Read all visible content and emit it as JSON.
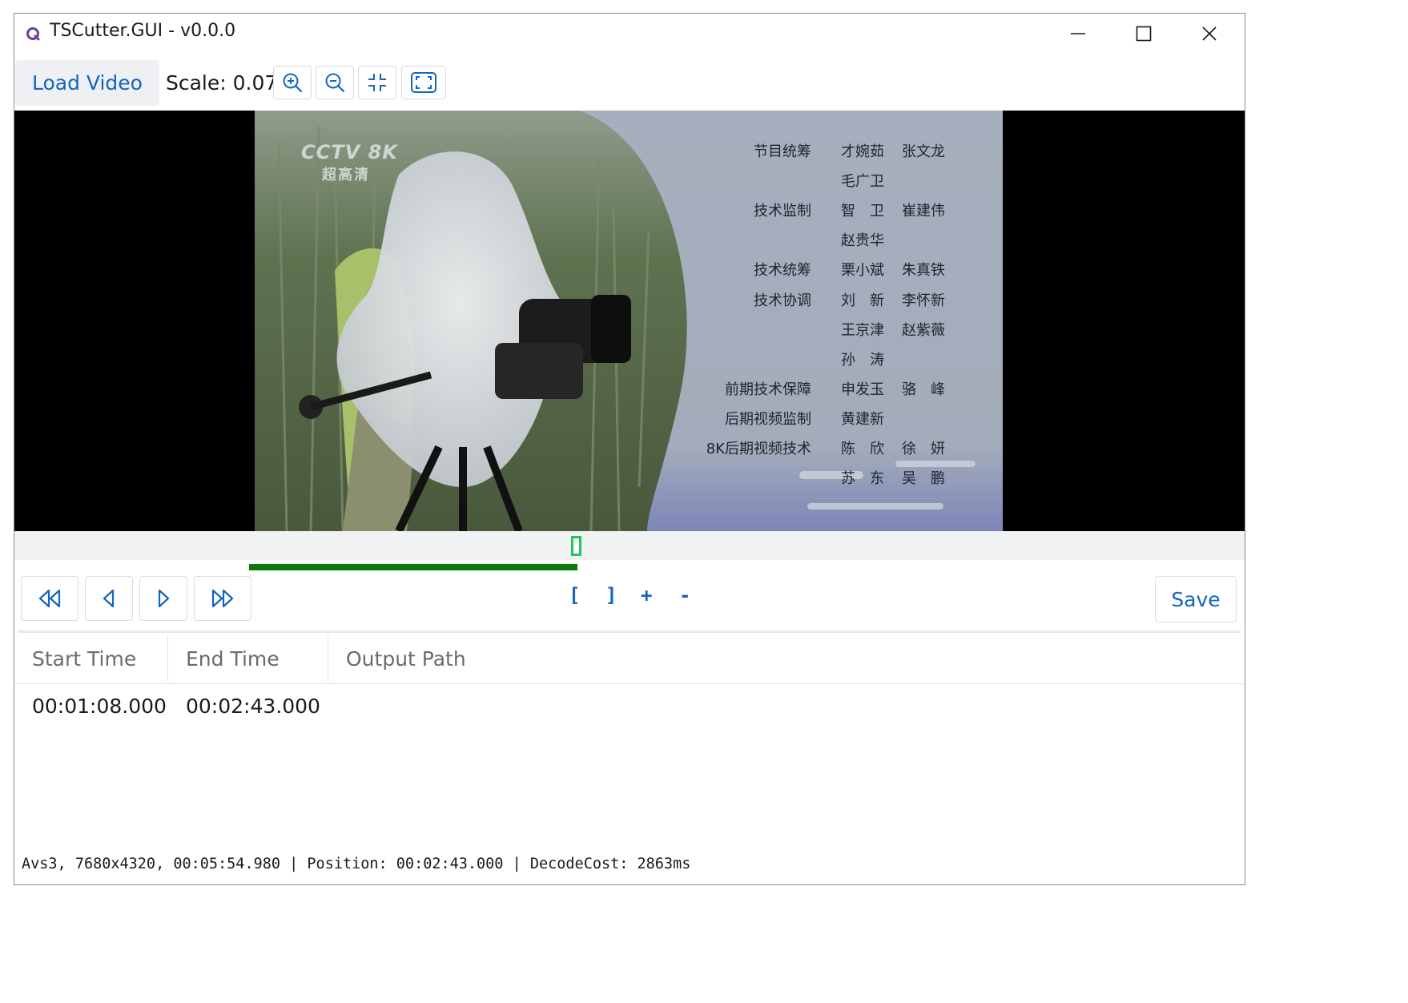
{
  "window": {
    "title": "TSCutter.GUI - v0.0.0",
    "icons": {
      "minimize": "minimize-icon",
      "maximize": "maximize-icon",
      "close": "close-icon"
    }
  },
  "toolbar": {
    "load_video_label": "Load Video",
    "scale_text": "Scale: 0.07",
    "icons": [
      "zoom-in-icon",
      "zoom-out-icon",
      "fit-to-window-icon",
      "fullscreen-icon"
    ]
  },
  "video": {
    "watermark_top": "CCTV 8K",
    "watermark_bottom": "超高清",
    "credits": [
      {
        "role": "节目统筹",
        "names": [
          "才婉茹",
          "张文龙"
        ]
      },
      {
        "role": "",
        "names": [
          "毛广卫"
        ]
      },
      {
        "role": "技术监制",
        "names": [
          "智　卫",
          "崔建伟"
        ]
      },
      {
        "role": "",
        "names": [
          "赵贵华"
        ]
      },
      {
        "role": "技术统筹",
        "names": [
          "栗小斌",
          "朱真铁"
        ]
      },
      {
        "role": "技术协调",
        "names": [
          "刘　新",
          "李怀新"
        ]
      },
      {
        "role": "",
        "names": [
          "王京津",
          "赵紫薇"
        ]
      },
      {
        "role": "",
        "names": [
          "孙　涛"
        ]
      },
      {
        "role": "前期技术保障",
        "names": [
          "申发玉",
          "骆　峰"
        ]
      },
      {
        "role": "后期视频监制",
        "names": [
          "黄建新"
        ]
      },
      {
        "role": "8K后期视频技术",
        "names": [
          "陈　欣",
          "徐　妍"
        ]
      },
      {
        "role": "",
        "names": [
          "苏　东",
          "吴　鹏"
        ]
      }
    ]
  },
  "timeline": {
    "played_fraction": 0.468,
    "accent_color": "#0a7a0a",
    "marker_color": "#22c55e"
  },
  "controls": {
    "icons": [
      "skip-back-icon",
      "step-back-icon",
      "step-forward-icon",
      "skip-forward-icon"
    ],
    "mark_start": "[",
    "mark_end": "]",
    "add": "+",
    "remove": "-",
    "save_label": "Save"
  },
  "table": {
    "headers": [
      "Start Time",
      "End Time",
      "Output Path"
    ],
    "rows": [
      {
        "start": "00:01:08.000",
        "end": "00:02:43.000",
        "output": ""
      }
    ]
  },
  "status_bar": {
    "text": "Avs3, 7680x4320, 00:05:54.980 | Position: 00:02:43.000 | DecodeCost: 2863ms"
  },
  "colors": {
    "accent": "#1565c0",
    "button_bg": "#eef0f3"
  }
}
